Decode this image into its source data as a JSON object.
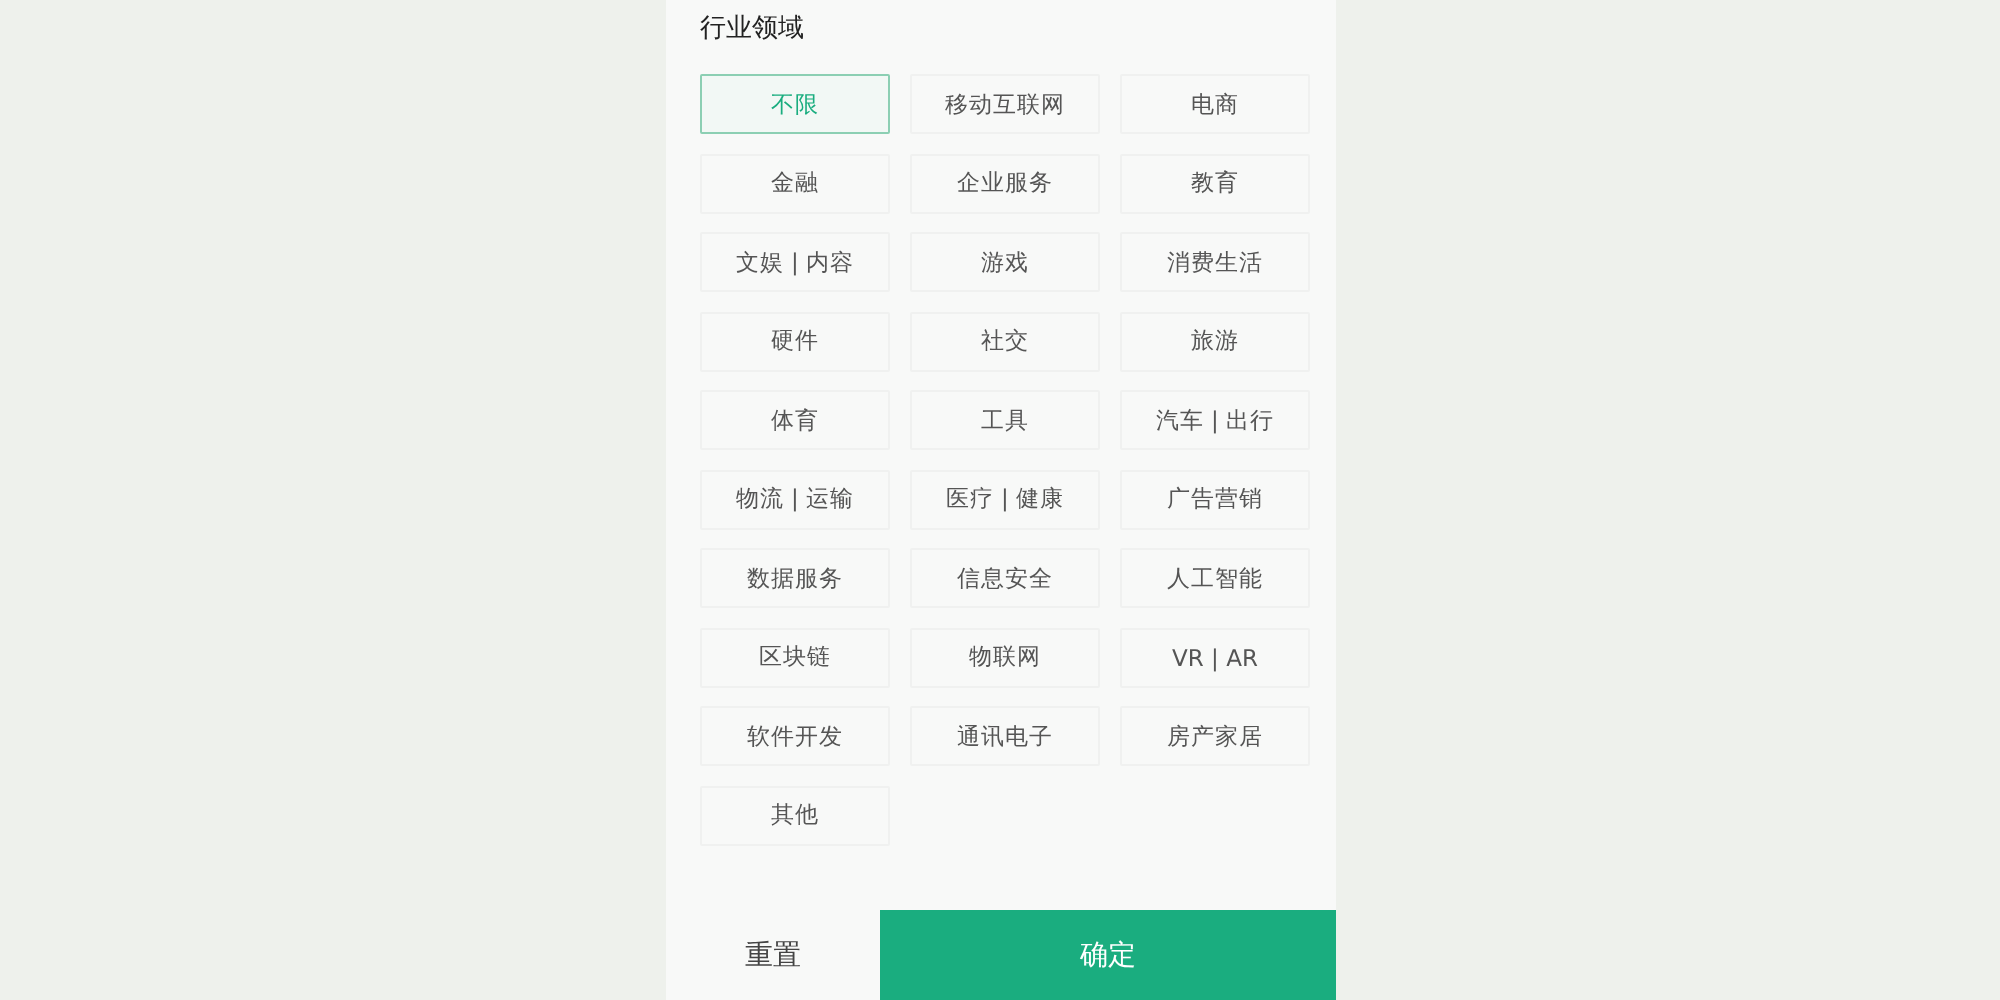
{
  "section_title": "行业领域",
  "options": [
    {
      "label": "不限",
      "selected": true
    },
    {
      "label": "移动互联网",
      "selected": false
    },
    {
      "label": "电商",
      "selected": false
    },
    {
      "label": "金融",
      "selected": false
    },
    {
      "label": "企业服务",
      "selected": false
    },
    {
      "label": "教育",
      "selected": false
    },
    {
      "label": "文娱 | 内容",
      "selected": false
    },
    {
      "label": "游戏",
      "selected": false
    },
    {
      "label": "消费生活",
      "selected": false
    },
    {
      "label": "硬件",
      "selected": false
    },
    {
      "label": "社交",
      "selected": false
    },
    {
      "label": "旅游",
      "selected": false
    },
    {
      "label": "体育",
      "selected": false
    },
    {
      "label": "工具",
      "selected": false
    },
    {
      "label": "汽车 | 出行",
      "selected": false
    },
    {
      "label": "物流 | 运输",
      "selected": false
    },
    {
      "label": "医疗 | 健康",
      "selected": false
    },
    {
      "label": "广告营销",
      "selected": false
    },
    {
      "label": "数据服务",
      "selected": false
    },
    {
      "label": "信息安全",
      "selected": false
    },
    {
      "label": "人工智能",
      "selected": false
    },
    {
      "label": "区块链",
      "selected": false
    },
    {
      "label": "物联网",
      "selected": false
    },
    {
      "label": "VR | AR",
      "selected": false
    },
    {
      "label": "软件开发",
      "selected": false
    },
    {
      "label": "通讯电子",
      "selected": false
    },
    {
      "label": "房产家居",
      "selected": false
    },
    {
      "label": "其他",
      "selected": false
    }
  ],
  "buttons": {
    "reset": "重置",
    "confirm": "确定"
  }
}
